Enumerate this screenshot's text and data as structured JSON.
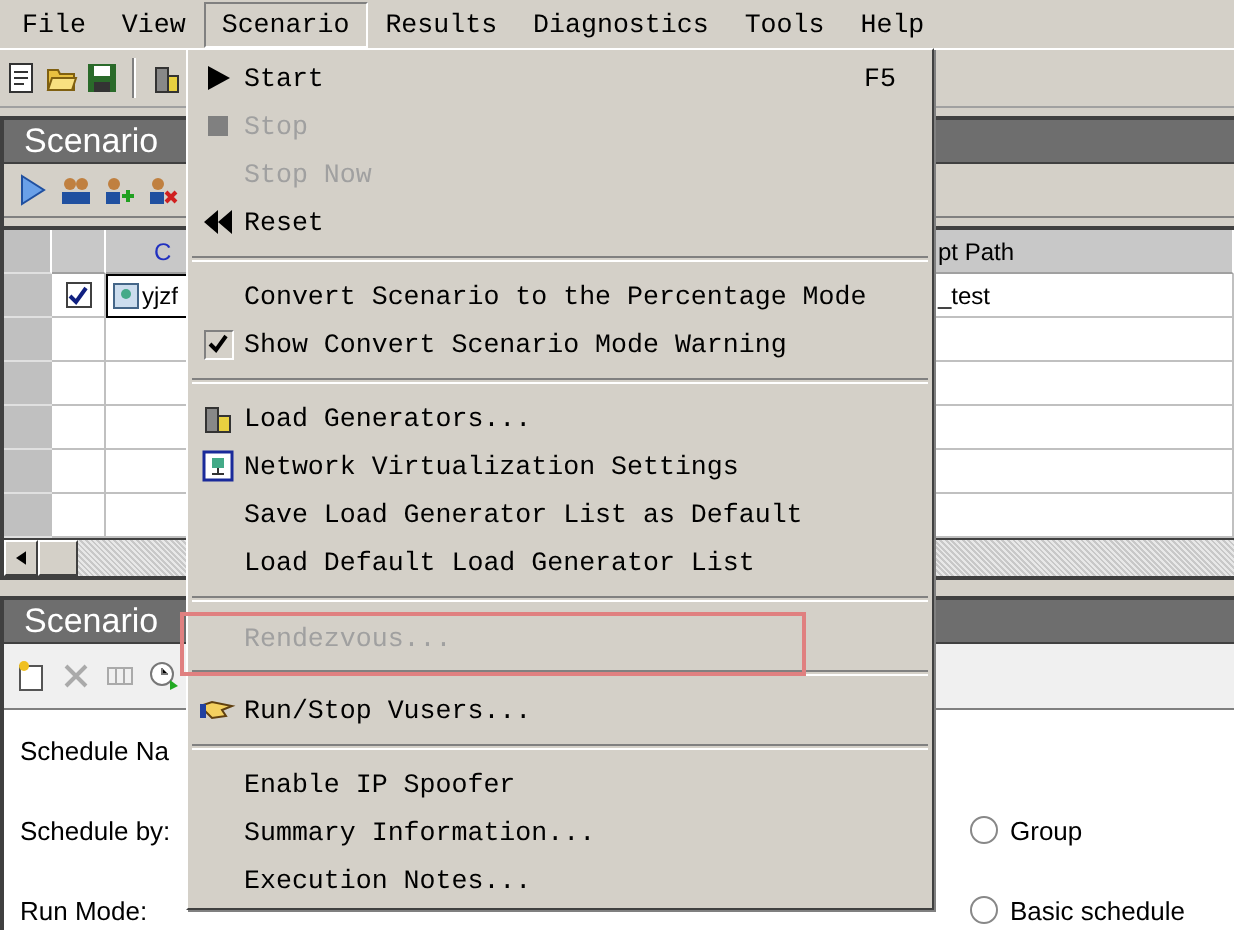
{
  "menubar": [
    {
      "label": "File",
      "selected": false
    },
    {
      "label": "View",
      "selected": false
    },
    {
      "label": "Scenario",
      "selected": true
    },
    {
      "label": "Results",
      "selected": false
    },
    {
      "label": "Diagnostics",
      "selected": false
    },
    {
      "label": "Tools",
      "selected": false
    },
    {
      "label": "Help",
      "selected": false
    }
  ],
  "scenario_groups": {
    "title": "Scenario",
    "columns": [
      "C",
      "pt Path"
    ],
    "rows": [
      {
        "checked": true,
        "name": "yjzf",
        "path": "_test"
      }
    ]
  },
  "scenario_schedule": {
    "title": "Scenario",
    "fields": [
      {
        "label": "Schedule Na"
      },
      {
        "label": "Schedule by:",
        "option": {
          "label": "Group",
          "selected": false
        }
      },
      {
        "label": "Run Mode:",
        "option": {
          "label": "Basic schedule",
          "selected": false
        }
      }
    ]
  },
  "menu": {
    "items": [
      {
        "kind": "item",
        "label": "Start",
        "shortcut": "F5",
        "disabled": false,
        "checked": false,
        "outlined": false
      },
      {
        "kind": "item",
        "label": "Stop",
        "disabled": true,
        "checked": false,
        "outlined": false
      },
      {
        "kind": "item",
        "label": "Stop Now",
        "disabled": true,
        "checked": false,
        "outlined": false
      },
      {
        "kind": "item",
        "label": "Reset",
        "disabled": false,
        "checked": false,
        "outlined": false
      },
      {
        "kind": "separator"
      },
      {
        "kind": "item",
        "label": "Convert Scenario to the Percentage Mode",
        "disabled": false,
        "checked": false,
        "outlined": false
      },
      {
        "kind": "item",
        "label": "Show Convert Scenario Mode Warning",
        "disabled": false,
        "checked": true,
        "outlined": false
      },
      {
        "kind": "separator"
      },
      {
        "kind": "item",
        "label": "Load Generators...",
        "disabled": false,
        "checked": false,
        "outlined": false
      },
      {
        "kind": "item",
        "label": "Network Virtualization Settings",
        "disabled": false,
        "checked": false,
        "outlined": false
      },
      {
        "kind": "item",
        "label": "Save Load Generator List as Default",
        "disabled": false,
        "checked": false,
        "outlined": false
      },
      {
        "kind": "item",
        "label": "Load Default Load Generator List",
        "disabled": false,
        "checked": false,
        "outlined": false
      },
      {
        "kind": "separator"
      },
      {
        "kind": "item",
        "label": "Rendezvous...",
        "disabled": true,
        "checked": false,
        "outlined": true
      },
      {
        "kind": "separator"
      },
      {
        "kind": "item",
        "label": "Run/Stop Vusers...",
        "disabled": false,
        "checked": false,
        "outlined": false
      },
      {
        "kind": "separator"
      },
      {
        "kind": "item",
        "label": "Enable IP Spoofer",
        "disabled": false,
        "checked": false,
        "outlined": false
      },
      {
        "kind": "item",
        "label": "Summary Information...",
        "disabled": false,
        "checked": false,
        "outlined": false
      },
      {
        "kind": "item",
        "label": "Execution Notes...",
        "disabled": false,
        "checked": false,
        "outlined": false
      }
    ]
  }
}
